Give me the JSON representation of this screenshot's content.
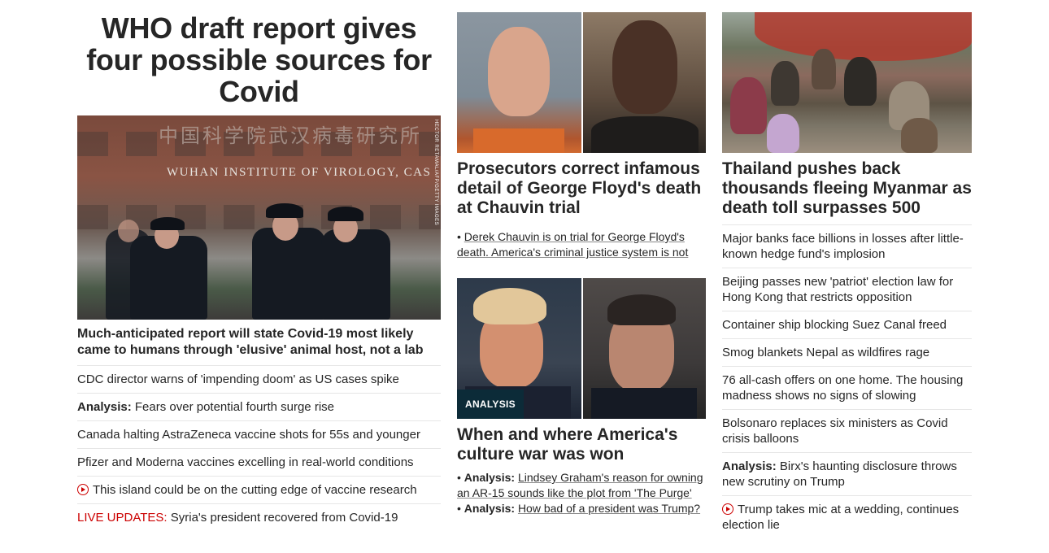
{
  "lead": {
    "headline": "WHO draft report gives four possible sources for Covid",
    "image": {
      "sign_text": "WUHAN INSTITUTE OF VIROLOGY, CAS",
      "credit": "HECTOR RETAMAL/AFP/GETTY IMAGES"
    },
    "subheadline": "Much-anticipated report will state Covid-19 most likely came to humans through 'elusive' animal host, not a lab",
    "items": [
      {
        "prefix": "",
        "text": "CDC director warns of 'impending doom' as US cases spike"
      },
      {
        "prefix": "Analysis:",
        "text": " Fears over potential fourth surge rise"
      },
      {
        "prefix": "",
        "text": "Canada halting AstraZeneca vaccine shots for 55s and younger"
      },
      {
        "prefix": "",
        "text": "Pfizer and Moderna vaccines excelling in real-world conditions"
      },
      {
        "prefix": "",
        "text": "This island could be on the cutting edge of vaccine research",
        "video": true
      },
      {
        "live": "LIVE UPDATES:",
        "text": " Syria's president recovered from Covid-19"
      }
    ]
  },
  "middle": {
    "card1": {
      "title": "Prosecutors correct infamous detail of George Floyd's death at Chauvin trial",
      "bullet": "Derek Chauvin is on trial for George Floyd's death. America's criminal justice system is not"
    },
    "card2": {
      "badge": "ANALYSIS",
      "title": "When and where America's culture war was won",
      "bullets": [
        {
          "prefix": "Analysis:",
          "text": "Lindsey Graham's reason for owning an AR-15 sounds like the plot from 'The Purge'"
        },
        {
          "prefix": "Analysis:",
          "text": "How bad of a president was Trump?"
        }
      ]
    }
  },
  "right": {
    "title": "Thailand pushes back thousands fleeing Myanmar as death toll surpasses 500",
    "items": [
      {
        "prefix": "",
        "text": "Major banks face billions in losses after little-known hedge fund's implosion"
      },
      {
        "prefix": "",
        "text": "Beijing passes new 'patriot' election law for Hong Kong that restricts opposition"
      },
      {
        "prefix": "",
        "text": "Container ship blocking Suez Canal freed"
      },
      {
        "prefix": "",
        "text": "Smog blankets Nepal as wildfires rage"
      },
      {
        "prefix": "",
        "text": "76 all-cash offers on one home. The housing madness shows no signs of slowing"
      },
      {
        "prefix": "",
        "text": "Bolsonaro replaces six ministers as Covid crisis balloons"
      },
      {
        "prefix": "Analysis:",
        "text": " Birx's haunting disclosure throws new scrutiny on Trump"
      },
      {
        "prefix": "",
        "text": "Trump takes mic at a wedding, continues election lie",
        "video": true
      }
    ]
  },
  "colors": {
    "text": "#262626",
    "live_red": "#cc0000",
    "badge_bg": "#0c2b38",
    "divider": "#e6e6e6"
  },
  "icons": [
    "play-icon"
  ]
}
